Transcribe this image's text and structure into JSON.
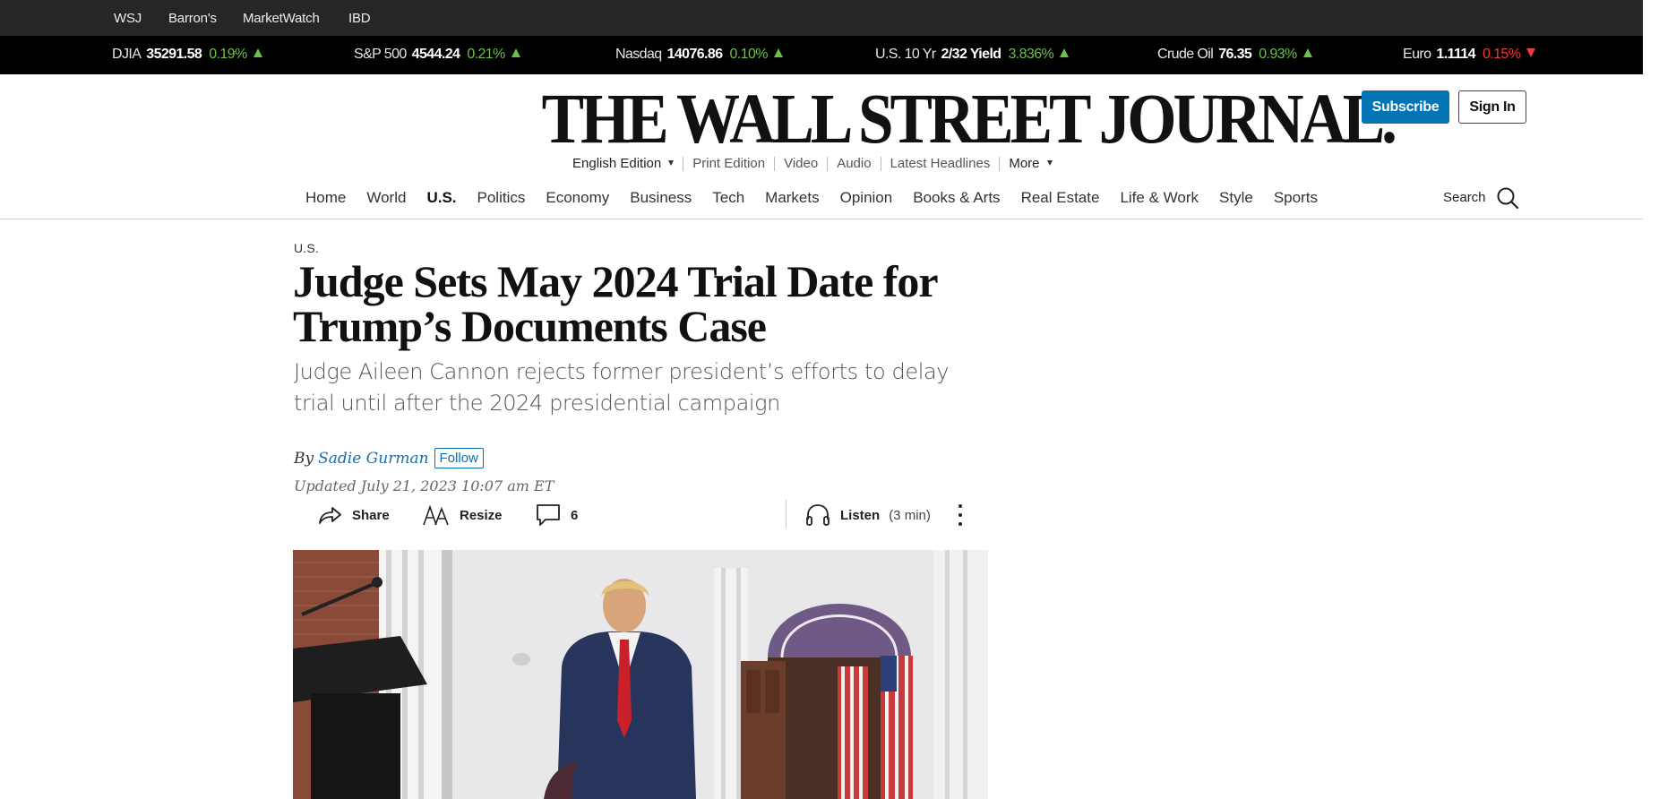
{
  "sites": [
    "WSJ",
    "Barron's",
    "MarketWatch",
    "IBD"
  ],
  "ticker": [
    {
      "name": "DJIA",
      "value": "35291.58",
      "change": "0.19%",
      "direction": "up"
    },
    {
      "name": "S&P 500",
      "value": "4544.24",
      "change": "0.21%",
      "direction": "up"
    },
    {
      "name": "Nasdaq",
      "value": "14076.86",
      "change": "0.10%",
      "direction": "up"
    },
    {
      "name": "U.S. 10 Yr",
      "value": "2/32 Yield",
      "change": "3.836%",
      "direction": "up"
    },
    {
      "name": "Crude Oil",
      "value": "76.35",
      "change": "0.93%",
      "direction": "up"
    },
    {
      "name": "Euro",
      "value": "1.1114",
      "change": "0.15%",
      "direction": "down"
    }
  ],
  "masthead": {
    "title": "THE WALL STREET JOURNAL."
  },
  "header_buttons": {
    "subscribe": "Subscribe",
    "sign_in": "Sign In"
  },
  "edition_bar": [
    "English Edition",
    "Print Edition",
    "Video",
    "Audio",
    "Latest Headlines",
    "More"
  ],
  "section_nav": [
    "Home",
    "World",
    "U.S.",
    "Politics",
    "Economy",
    "Business",
    "Tech",
    "Markets",
    "Opinion",
    "Books & Arts",
    "Real Estate",
    "Life & Work",
    "Style",
    "Sports"
  ],
  "section_nav_active": "U.S.",
  "search": {
    "label": "Search"
  },
  "article": {
    "section": "U.S.",
    "headline_line1": "Judge Sets May 2024 Trial Date for",
    "headline_line2": "Trump’s Documents Case",
    "dek": "Judge Aileen Cannon rejects former president’s efforts to delay trial until after the 2024 presidential campaign",
    "by": "By",
    "author": "Sadie Gurman",
    "follow": "Follow",
    "timestamp": "Updated July 21, 2023 10:07 am ET"
  },
  "tools": {
    "share": "Share",
    "resize": "Resize",
    "comments": "6",
    "listen": "Listen",
    "listen_duration": "(3 min)"
  },
  "colors": {
    "brand_blue": "#0274b6",
    "ticker_up": "#6cc04a",
    "ticker_down": "#ee3a3a",
    "top_bar": "#262626"
  }
}
